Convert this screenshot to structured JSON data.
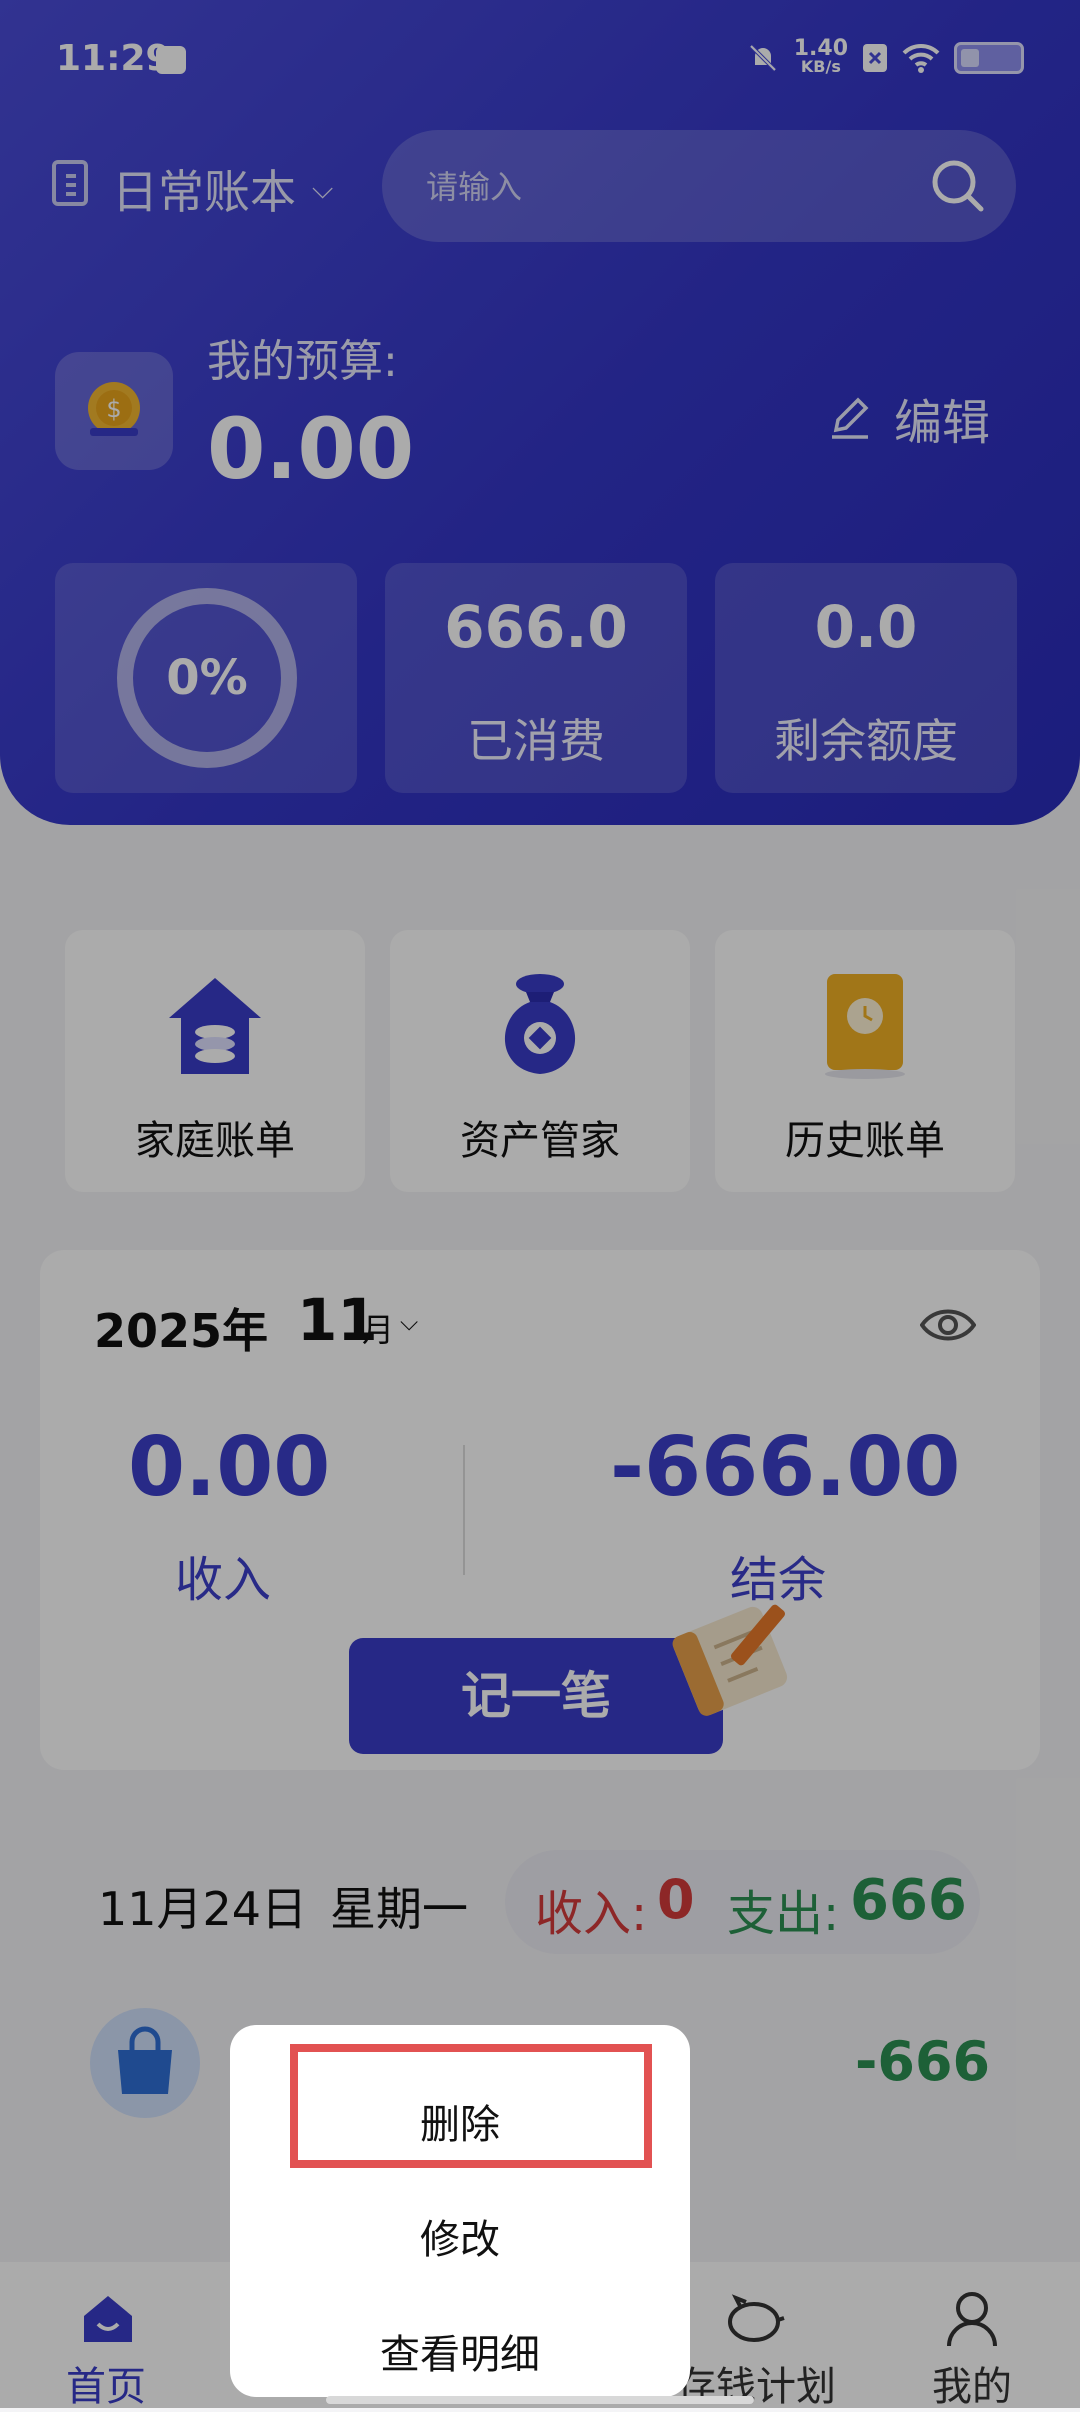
{
  "status_bar": {
    "time": "11:29",
    "net_speed_value": "1.40",
    "net_speed_unit": "KB/s"
  },
  "header": {
    "ledger_name": "日常账本",
    "search_placeholder": "请输入",
    "budget_label": "我的预算:",
    "budget_value": "0.00",
    "edit_label": "编辑",
    "progress_percent": "0%",
    "spent_value": "666.0",
    "spent_label": "已消费",
    "remaining_value": "0.0",
    "remaining_label": "剩余额度"
  },
  "shortcuts": [
    {
      "label": "家庭账单",
      "icon": "house-coins-icon"
    },
    {
      "label": "资产管家",
      "icon": "money-bag-icon"
    },
    {
      "label": "历史账单",
      "icon": "clock-book-icon"
    }
  ],
  "month_card": {
    "year": "2025年",
    "month": "11",
    "month_unit": "月",
    "income_value": "0.00",
    "income_label": "收入",
    "balance_value": "-666.00",
    "balance_label": "结余",
    "record_button": "记一笔"
  },
  "day": {
    "date": "11月24日",
    "weekday": "星期一",
    "income_label": "收入:",
    "income_value": "0",
    "expense_label": "支出:",
    "expense_value": "666"
  },
  "transaction": {
    "amount": "-666"
  },
  "bottom_nav": {
    "home": "首页",
    "saving_plan": "存钱计划",
    "mine": "我的"
  },
  "context_menu": {
    "delete": "删除",
    "edit": "修改",
    "view_detail": "查看明细"
  },
  "colors": {
    "primary": "#3a3cc8",
    "income_red": "#d23b3b",
    "expense_green": "#2c8f52",
    "highlight": "#e25252"
  }
}
